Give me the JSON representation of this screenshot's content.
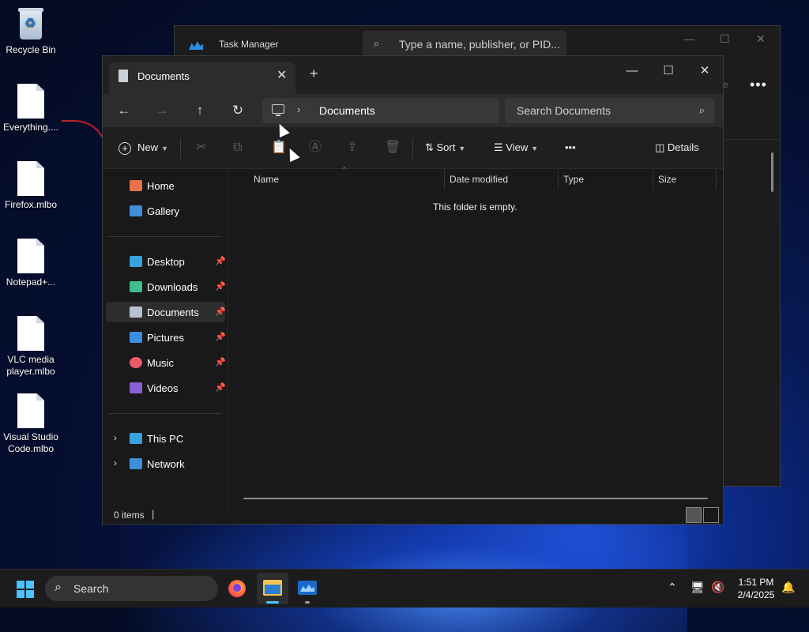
{
  "desktop": {
    "icons": [
      {
        "label": "Recycle Bin"
      },
      {
        "label": "Everything...."
      },
      {
        "label": "Firefox.mlbo"
      },
      {
        "label": "Notepad+..."
      },
      {
        "label": "VLC media player.mlbo"
      },
      {
        "label": "Visual Studio Code.mlbo"
      }
    ]
  },
  "task_manager": {
    "title": "Task Manager",
    "search_placeholder": "Type a name, publisher, or PID...",
    "side_text": "e",
    "more": "•••"
  },
  "explorer": {
    "tab_title": "Documents",
    "new_tab": "+",
    "window_controls": {
      "minimize": "—",
      "maximize": "☐",
      "close": "✕"
    },
    "address": {
      "crumb": "Documents",
      "separator": "›"
    },
    "search_placeholder": "Search Documents",
    "toolbar": {
      "new": "New",
      "sort": "Sort",
      "view": "View",
      "more": "•••",
      "details": "Details"
    },
    "sidebar": {
      "quick": [
        {
          "label": "Home",
          "color": "#e6734a"
        },
        {
          "label": "Gallery",
          "color": "#3f8fd8"
        }
      ],
      "pinned": [
        {
          "label": "Desktop",
          "color": "#36a3e0"
        },
        {
          "label": "Downloads",
          "color": "#3fbf8f"
        },
        {
          "label": "Documents",
          "color": "#b9c3cf"
        },
        {
          "label": "Pictures",
          "color": "#3a8fe3"
        },
        {
          "label": "Music",
          "color": "#e85b6a"
        },
        {
          "label": "Videos",
          "color": "#8a5fd8"
        }
      ],
      "locations": [
        {
          "label": "This PC"
        },
        {
          "label": "Network"
        }
      ]
    },
    "columns": [
      "Name",
      "Date modified",
      "Type",
      "Size"
    ],
    "empty_message": "This folder is empty.",
    "status": "0 items"
  },
  "taskbar": {
    "search_label": "Search",
    "time": "1:51 PM",
    "date": "2/4/2025"
  }
}
